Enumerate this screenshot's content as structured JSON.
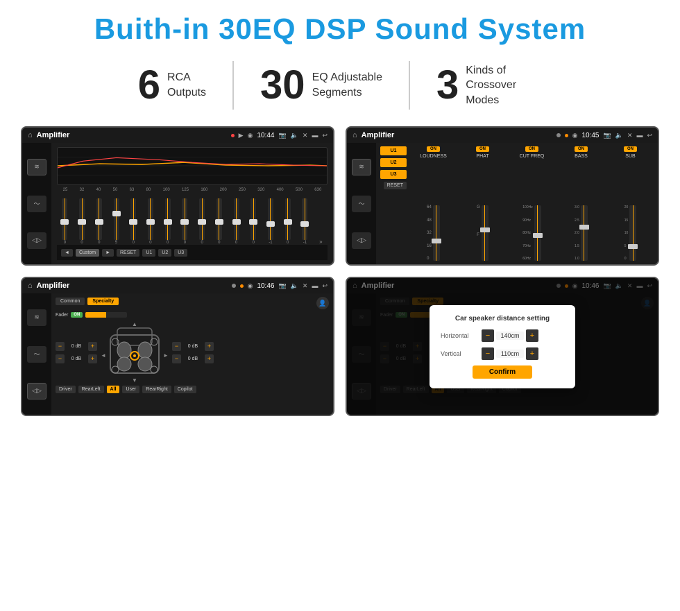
{
  "title": "Buith-in 30EQ DSP Sound System",
  "stats": [
    {
      "number": "6",
      "label_line1": "RCA",
      "label_line2": "Outputs"
    },
    {
      "number": "30",
      "label_line1": "EQ Adjustable",
      "label_line2": "Segments"
    },
    {
      "number": "3",
      "label_line1": "Kinds of",
      "label_line2": "Crossover Modes"
    }
  ],
  "screens": {
    "eq_screen": {
      "app_name": "Amplifier",
      "time": "10:44",
      "eq_frequencies": [
        "25",
        "32",
        "40",
        "50",
        "63",
        "80",
        "100",
        "125",
        "160",
        "200",
        "250",
        "320",
        "400",
        "500",
        "630"
      ],
      "eq_values": [
        "0",
        "0",
        "0",
        "5",
        "0",
        "0",
        "0",
        "0",
        "0",
        "0",
        "0",
        "0",
        "-1",
        "0",
        "-1"
      ],
      "controls": [
        "◄",
        "Custom",
        "►",
        "RESET",
        "U1",
        "U2",
        "U3"
      ]
    },
    "crossover_screen": {
      "app_name": "Amplifier",
      "time": "10:45",
      "presets": [
        "U1",
        "U2",
        "U3"
      ],
      "channels": [
        {
          "name": "LOUDNESS",
          "toggle": "ON"
        },
        {
          "name": "PHAT",
          "toggle": "ON"
        },
        {
          "name": "CUT FREQ",
          "toggle": "ON"
        },
        {
          "name": "BASS",
          "toggle": "ON"
        },
        {
          "name": "SUB",
          "toggle": "ON"
        }
      ],
      "reset_label": "RESET"
    },
    "speaker_screen": {
      "app_name": "Amplifier",
      "time": "10:46",
      "tabs": [
        "Common",
        "Specialty"
      ],
      "fader_label": "Fader",
      "fader_toggle": "ON",
      "vol_labels": [
        "0 dB",
        "0 dB",
        "0 dB",
        "0 dB"
      ],
      "bottom_btns": [
        "Driver",
        "RearLeft",
        "All",
        "User",
        "RearRight",
        "Copilot"
      ]
    },
    "dialog_screen": {
      "app_name": "Amplifier",
      "time": "10:46",
      "tabs": [
        "Common",
        "Specialty"
      ],
      "dialog_title": "Car speaker distance setting",
      "horizontal_label": "Horizontal",
      "horizontal_val": "140cm",
      "vertical_label": "Vertical",
      "vertical_val": "110cm",
      "confirm_label": "Confirm",
      "bottom_btns": [
        "Driver",
        "RearLeft",
        "All",
        "User",
        "RearRight",
        "Copilot"
      ]
    }
  },
  "icons": {
    "home": "⌂",
    "play": "▶",
    "pause": "⏸",
    "back": "↩",
    "volume": "♪",
    "location": "◉",
    "camera": "📷",
    "minus": "−",
    "plus": "+"
  }
}
